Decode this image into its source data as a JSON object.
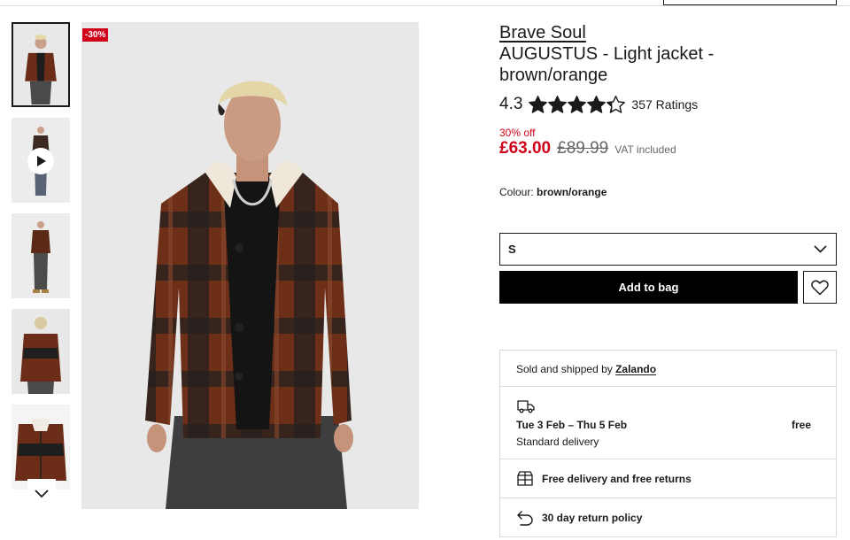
{
  "gallery": {
    "discount_badge": "-30%",
    "thumbnails": [
      "front",
      "video",
      "full-front",
      "back",
      "flat-lay"
    ]
  },
  "product": {
    "brand": "Brave Soul",
    "title": "AUGUSTUS - Light jacket - brown/orange",
    "rating_value": "4.3",
    "rating_stars": 4.3,
    "rating_max": 5,
    "rating_count": "357 Ratings",
    "discount_text": "30% off",
    "price_now": "£63.00",
    "price_was": "£89.99",
    "vat_text": "VAT included",
    "colour_label": "Colour:",
    "colour_value": "brown/orange"
  },
  "purchase": {
    "size_selected": "S",
    "add_to_bag_label": "Add to bag"
  },
  "shipping": {
    "sold_by_prefix": "Sold and shipped by",
    "seller": "Zalando",
    "delivery_dates": "Tue 3 Feb – Thu 5 Feb",
    "delivery_type": "Standard delivery",
    "delivery_price": "free",
    "free_returns": "Free delivery and free returns",
    "return_policy": "30 day return policy"
  },
  "colors": {
    "sale_red": "#d0021b",
    "button_black": "#000000",
    "border_grey": "#d9d9d9"
  }
}
